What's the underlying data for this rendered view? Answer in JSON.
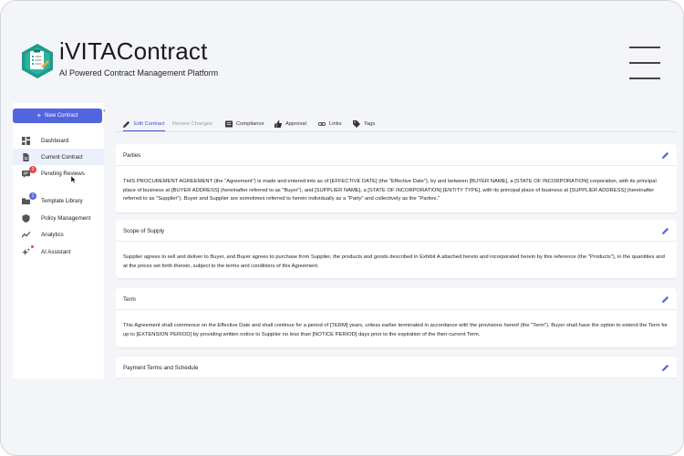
{
  "app": {
    "title": "iVITAContract",
    "subtitle": "AI Powered Contract Management Platform"
  },
  "sidebar": {
    "new_button": "New Contract",
    "items": [
      {
        "label": "Dashboard",
        "icon": "dashboard-icon"
      },
      {
        "label": "Current Contract",
        "icon": "document-icon",
        "active": true
      },
      {
        "label": "Pending Reviews",
        "icon": "review-icon",
        "badge": "3"
      },
      {
        "label": "Template Library",
        "icon": "folder-icon",
        "badge": "1"
      },
      {
        "label": "Policy Management",
        "icon": "shield-icon"
      },
      {
        "label": "Analytics",
        "icon": "analytics-icon"
      },
      {
        "label": "AI Assistant",
        "icon": "sparkle-icon"
      }
    ]
  },
  "tabs": [
    {
      "label": "Edit Contract",
      "icon": "pencil-icon",
      "active": true
    },
    {
      "label": "Review Changes",
      "icon": "",
      "muted": true
    },
    {
      "label": "Compliance",
      "icon": "checklist-icon"
    },
    {
      "label": "Approval",
      "icon": "thumbs-up-icon"
    },
    {
      "label": "Links",
      "icon": "link-icon"
    },
    {
      "label": "Tags",
      "icon": "tag-icon"
    }
  ],
  "sections": [
    {
      "title": "Parties",
      "body": "THIS PROCUREMENT AGREEMENT (the \"Agreement\") is made and entered into as of [EFFECTIVE DATE] (the \"Effective Date\"), by and between [BUYER NAME], a [STATE OF INCORPORATION] corporation, with its principal place of business at [BUYER ADDRESS] (hereinafter referred to as \"Buyer\"), and [SUPPLIER NAME], a [STATE OF INCORPORATION] [ENTITY TYPE], with its principal place of business at [SUPPLIER ADDRESS] (hereinafter referred to as \"Supplier\"). Buyer and Supplier are sometimes referred to herein individually as a \"Party\" and collectively as the \"Parties.\""
    },
    {
      "title": "Scope of Supply",
      "body": "Supplier agrees to sell and deliver to Buyer, and Buyer agrees to purchase from Supplier, the products and goods described in Exhibit A attached hereto and incorporated herein by this reference (the \"Products\"), in the quantities and at the prices set forth therein, subject to the terms and conditions of this Agreement."
    },
    {
      "title": "Term",
      "body": "This Agreement shall commence on the Effective Date and shall continue for a period of [TERM] years, unless earlier terminated in accordance with the provisions hereof (the \"Term\"). Buyer shall have the option to extend the Term for up to [EXTENSION PERIOD] by providing written notice to Supplier no less than [NOTICE PERIOD] days prior to the expiration of the then-current Term."
    },
    {
      "title": "Payment Terms and Schedule",
      "body": ""
    }
  ],
  "colors": {
    "accent": "#5265df",
    "active_tab": "#3d4fd6",
    "badge_red": "#e54848",
    "badge_blue": "#5a6ae0"
  }
}
